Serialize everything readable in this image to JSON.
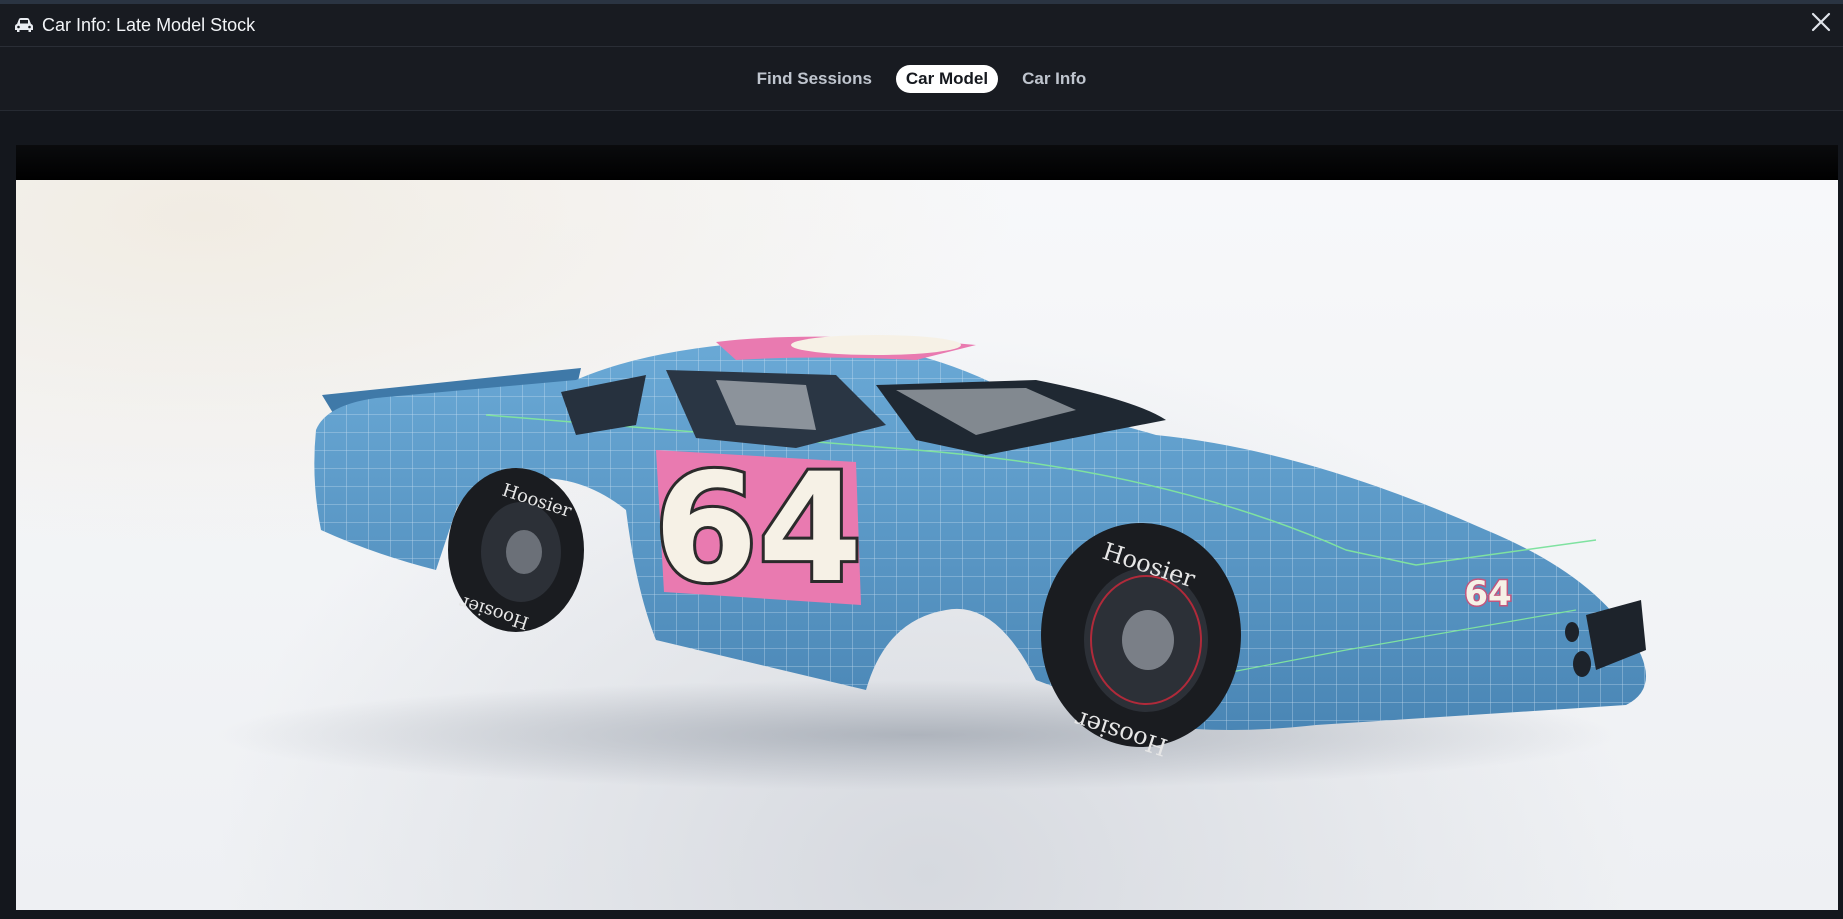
{
  "window": {
    "title": "Car Info: Late Model Stock",
    "icons": {
      "title": "car-icon",
      "close": "close-icon"
    }
  },
  "tabs": [
    {
      "label": "Find Sessions",
      "active": false
    },
    {
      "label": "Car Model",
      "active": true
    },
    {
      "label": "Car Info",
      "active": false
    }
  ],
  "car": {
    "number": "64",
    "tire_brand": "Hoosier",
    "colors": {
      "body": "#5b9ccc",
      "number_panel": "#e97ab0",
      "number_fill": "#f6f1e6",
      "number_outline": "#2b2b2b"
    }
  },
  "theme": {
    "bg": "#14171d",
    "bar": "#181b21",
    "active_tab_bg": "#ffffff"
  }
}
